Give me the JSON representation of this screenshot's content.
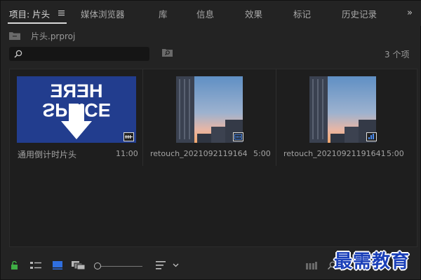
{
  "tabs": [
    {
      "label": "项目: 片头"
    },
    {
      "label": "媒体浏览器"
    },
    {
      "label": "库"
    },
    {
      "label": "信息"
    },
    {
      "label": "效果"
    },
    {
      "label": "标记"
    },
    {
      "label": "历史记录"
    }
  ],
  "overflow_label": "»",
  "project": {
    "path": "片头.prproj",
    "item_count": "3 个项"
  },
  "search": {
    "value": "",
    "placeholder": ""
  },
  "clips": [
    {
      "name": "通用倒计时片头",
      "duration": "11:00",
      "thumb_line1": "HERE",
      "thumb_line2": "SPLICE"
    },
    {
      "name": "retouch_20210921191641...",
      "duration": "5:00"
    },
    {
      "name": "retouch_20210921191641",
      "duration": "5:00"
    }
  ],
  "watermark": "最需教育",
  "colors": {
    "accent_blue": "#2f6fe0",
    "lock_green": "#3fae45",
    "splice_bg": "#1f3a8a"
  }
}
